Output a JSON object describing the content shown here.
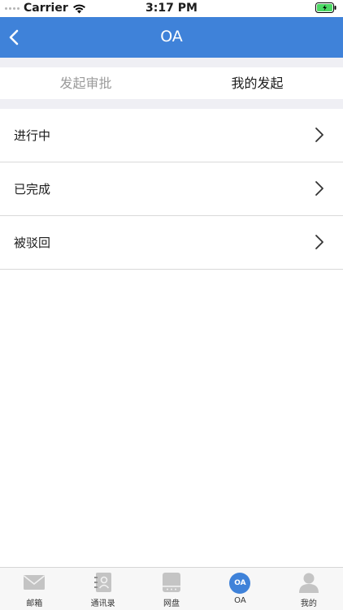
{
  "status_bar": {
    "carrier": "Carrier",
    "time": "3:17 PM"
  },
  "nav": {
    "title": "OA"
  },
  "tabs": [
    {
      "label": "发起审批",
      "active": false
    },
    {
      "label": "我的发起",
      "active": true
    }
  ],
  "list": [
    {
      "label": "进行中"
    },
    {
      "label": "已完成"
    },
    {
      "label": "被驳回"
    }
  ],
  "tab_bar": [
    {
      "label": "邮箱",
      "icon": "mail-icon"
    },
    {
      "label": "通讯录",
      "icon": "contacts-icon"
    },
    {
      "label": "网盘",
      "icon": "drive-icon"
    },
    {
      "label": "OA",
      "icon": "oa-icon",
      "icon_text": "OA",
      "active": true
    },
    {
      "label": "我的",
      "icon": "profile-icon"
    }
  ],
  "colors": {
    "accent": "#3f82d9",
    "background": "#efeff4",
    "battery": "#4cd964"
  }
}
